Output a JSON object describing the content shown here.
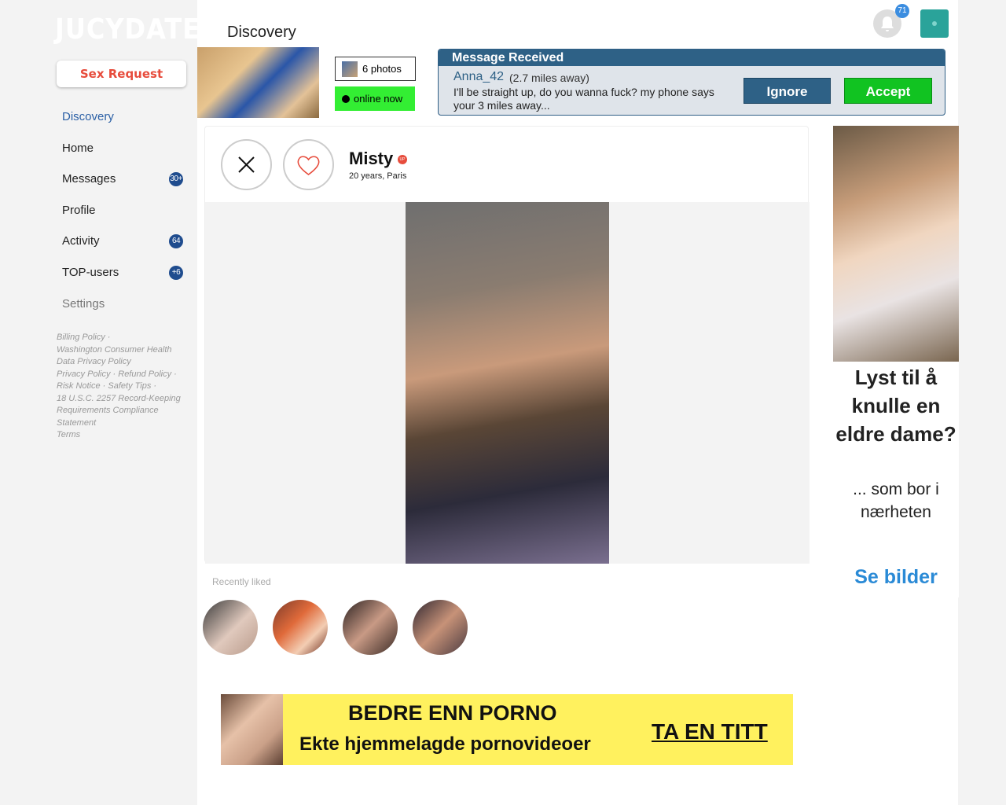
{
  "app": {
    "logo": "JUCYDATE",
    "sex_request": "Sex Request"
  },
  "nav": [
    {
      "label": "Discovery",
      "badge": ""
    },
    {
      "label": "Home",
      "badge": ""
    },
    {
      "label": "Messages",
      "badge": "30+"
    },
    {
      "label": "Profile",
      "badge": ""
    },
    {
      "label": "Activity",
      "badge": "64"
    },
    {
      "label": "TOP-users",
      "badge": "+6"
    },
    {
      "label": "Settings",
      "badge": ""
    }
  ],
  "footer_links": [
    "Billing Policy",
    "Washington Consumer Health Data Privacy Policy",
    "Privacy Policy",
    "Refund Policy",
    "Risk Notice",
    "Safety Tips",
    "18 U.S.C. 2257 Record-Keeping Requirements Compliance Statement",
    "Terms"
  ],
  "header": {
    "title": "Discovery",
    "notifications": "71"
  },
  "banner": {
    "photos": "6 photos",
    "online": "online now",
    "message": {
      "header": "Message Received",
      "user": "Anna_42",
      "distance": "(2.7 miles away)",
      "text": "I'll be straight up, do you wanna fuck?  my phone says your 3 miles away...",
      "ignore": "Ignore",
      "accept": "Accept"
    }
  },
  "profile": {
    "name": "Misty",
    "up_badge": "UP",
    "sub": "20 years, Paris"
  },
  "recently_liked": {
    "label": "Recently liked"
  },
  "ad_right": {
    "headline": "Lyst til å knulle en eldre dame?",
    "sub": "... som bor i nærheten",
    "cta": "Se bilder"
  },
  "ad_bottom": {
    "h1": "BEDRE ENN PORNO",
    "h2": "Ekte hjemmelagde pornovideoer",
    "cta": "TA EN TITT"
  }
}
